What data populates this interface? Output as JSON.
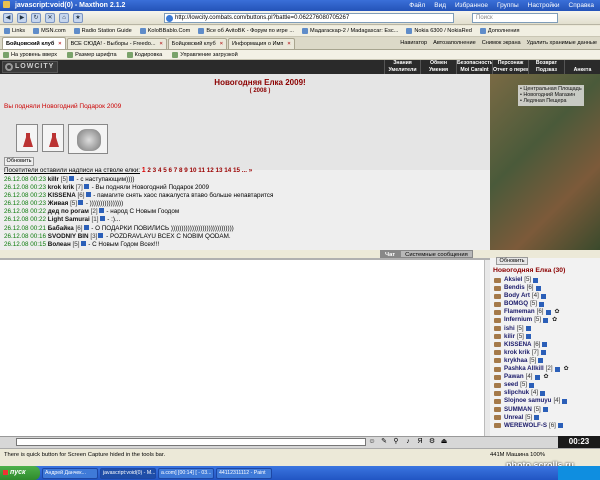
{
  "browser": {
    "title": "javascript:void(0) - Maxthon 2.1.2",
    "menu": [
      "Файл",
      "Вид",
      "Избранное",
      "Группы",
      "Настройки",
      "Справка"
    ],
    "address": "http://lowcity.combats.com/buttons.pl?battle=0.062276080705267",
    "search_placeholder": "Поиск",
    "links_label": "Links",
    "links": [
      "MSN.com",
      "Radio Station Guide",
      "KoloBBablo.Com",
      "Все об AvitoBK - Форум по игре ...",
      "Мадагаскар-2 / Madagascar: Esc...",
      "Nokia 6300 / NokiaRed",
      "Дополнения"
    ],
    "tabs": [
      {
        "label": "Бойцовский клуб",
        "active": true
      },
      {
        "label": "ВСЕ СЮДА! - Выборы - Freedo...",
        "active": false
      },
      {
        "label": "Бойцовский клуб",
        "active": false
      },
      {
        "label": "Информация о Имп",
        "active": false
      }
    ],
    "tabs_right": [
      "Навигатор",
      "Автозаполнение",
      "Снимок экрана",
      "Удалить хранимые данные"
    ],
    "toolbar2": [
      "На уровень вверх",
      "Размер шрифта",
      "Кодировка",
      "Управление загрузкой"
    ]
  },
  "game": {
    "logo": "LOWCITY",
    "nav": [
      "Знания",
      "Обмен",
      "Безопасность",
      "Персонаж",
      "Возврат",
      "",
      "Умелители",
      "Умения",
      "Moi Caralnt",
      "Отчет о переводах",
      "Подзказ",
      "Анкета"
    ],
    "side_links": [
      "Центральная Площадь",
      "Новогодний Магазин",
      "Ледяная Пещера"
    ],
    "event_title": "Новогодняя Елка 2009!",
    "event_year": "( 2008 )",
    "gift_msg": "Вы подняли Новогодний Подарок 2009",
    "refresh_label": "Обновить",
    "visitors_label": "Посетители оставили надписи на стволе елки:",
    "pages": [
      "1",
      "2",
      "3",
      "4",
      "5",
      "6",
      "7",
      "8",
      "9",
      "10",
      "11",
      "12",
      "13",
      "14",
      "15",
      "...",
      "»"
    ],
    "chat_lines": [
      {
        "ts": "26.12.08 00:23",
        "nick": "killr",
        "lvl": "[5]",
        "msg": "- с наступающим))))"
      },
      {
        "ts": "26.12.08 00:23",
        "nick": "krok krik",
        "lvl": "[7]",
        "msg": "- Вы подняли Новогодний Подарок 2009"
      },
      {
        "ts": "26.12.08 00:23",
        "nick": "KISSENA",
        "lvl": "[6]",
        "msg": "- памагите снять хаос пажалуста втаво больше непавтарится"
      },
      {
        "ts": "26.12.08 00:23",
        "nick": "Живая",
        "lvl": "[5]",
        "msg": "- ))))))))))))))))"
      },
      {
        "ts": "26.12.08 00:22",
        "nick": "дед по рогам",
        "lvl": "[2]",
        "msg": "- народ С Новым Гоодом"
      },
      {
        "ts": "26.12.08 00:22",
        "nick": "Light Samurai",
        "lvl": "[1]",
        "msg": "- :)..."
      },
      {
        "ts": "26.12.08 00:21",
        "nick": "Бабайка",
        "lvl": "[6]",
        "msg": "- О ПОДАРКИ ПОВИЛИСЬ ))))))))))))))))))))))))))))))"
      },
      {
        "ts": "26.12.08 00:16",
        "nick": "SVODNIY BIN",
        "lvl": "[3]",
        "msg": "- POZDRAVLAYU ВСЕХ С NOBIM QODAM."
      },
      {
        "ts": "26.12.08 00:15",
        "nick": "Волеан",
        "lvl": "[5]",
        "msg": "- С Новым Годом Всех!!!"
      }
    ],
    "chat_tabs": [
      "Чат",
      "Системные сообщения"
    ],
    "online_refresh": "Обновить",
    "online_title": "Новогодняя Елка (30)",
    "users": [
      {
        "name": "Aksiel",
        "lvl": "[5]",
        "badge": ""
      },
      {
        "name": "Bendis",
        "lvl": "[6]",
        "badge": ""
      },
      {
        "name": "Body Art",
        "lvl": "[4]",
        "badge": ""
      },
      {
        "name": "BOMGQ",
        "lvl": "[5]",
        "badge": ""
      },
      {
        "name": "Flameman",
        "lvl": "[6]",
        "badge": "✿"
      },
      {
        "name": "Infernium",
        "lvl": "[5]",
        "badge": "✿"
      },
      {
        "name": "ishi",
        "lvl": "[5]",
        "badge": ""
      },
      {
        "name": "kilir",
        "lvl": "[5]",
        "badge": ""
      },
      {
        "name": "KISSENA",
        "lvl": "[6]",
        "badge": ""
      },
      {
        "name": "krok krik",
        "lvl": "[7]",
        "badge": ""
      },
      {
        "name": "krykhaa",
        "lvl": "[5]",
        "badge": ""
      },
      {
        "name": "Pashka Allkill",
        "lvl": "[2]",
        "badge": "✿"
      },
      {
        "name": "Pawan",
        "lvl": "[4]",
        "badge": "✿"
      },
      {
        "name": "seed",
        "lvl": "[5]",
        "badge": ""
      },
      {
        "name": "slipchuk",
        "lvl": "[4]",
        "badge": ""
      },
      {
        "name": "Slojnoe samuyu",
        "lvl": "[4]",
        "badge": ""
      },
      {
        "name": "SUMMAN",
        "lvl": "[5]",
        "badge": ""
      },
      {
        "name": "Unreal",
        "lvl": "[5]",
        "badge": ""
      },
      {
        "name": "WEREWOLF-S",
        "lvl": "[6]",
        "badge": ""
      }
    ]
  },
  "status": {
    "text": "There is quick button for Screen Capture hided in the tools bar.",
    "info": "441M    Машина 100%",
    "clock": "00:23",
    "watermark": "photo.scrolls.ru"
  },
  "taskbar": {
    "start": "пуск",
    "tasks": [
      "Андрей Данчек...",
      "javascript:void(0) - M...",
      "a.com] [00:14] [ - 03...",
      "44112311112 - Paint"
    ]
  }
}
